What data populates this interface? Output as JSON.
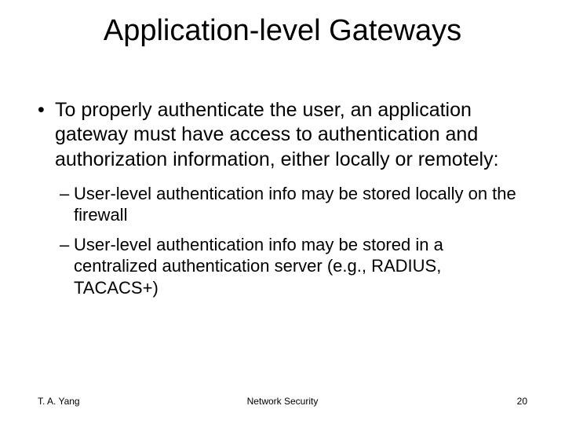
{
  "title": "Application-level Gateways",
  "bullets": {
    "main": "To properly authenticate the user, an application gateway must have access to authentication and authorization information, either locally or remotely:",
    "sub1": "User-level authentication info may be stored locally on the firewall",
    "sub2": "User-level authentication info may be stored in a centralized authentication server (e.g., RADIUS, TACACS+)"
  },
  "footer": {
    "author": "T. A. Yang",
    "subject": "Network Security",
    "page": "20"
  }
}
